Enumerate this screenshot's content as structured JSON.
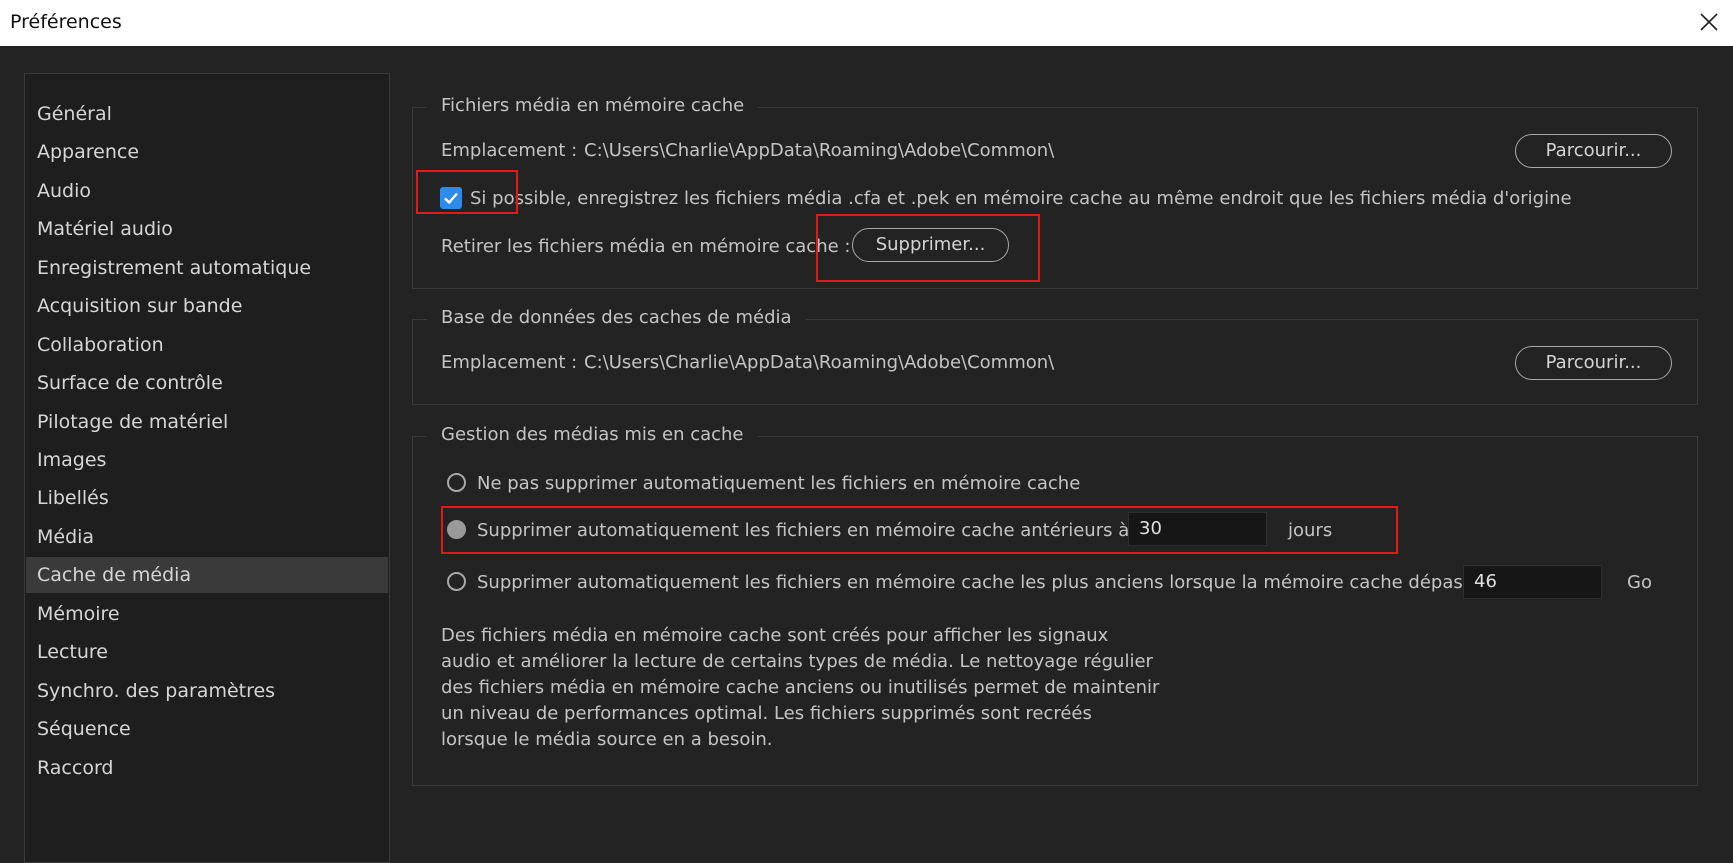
{
  "window": {
    "title": "Préférences"
  },
  "sidebar": {
    "items": [
      {
        "label": "Général"
      },
      {
        "label": "Apparence"
      },
      {
        "label": "Audio"
      },
      {
        "label": "Matériel audio"
      },
      {
        "label": "Enregistrement automatique"
      },
      {
        "label": "Acquisition sur bande"
      },
      {
        "label": "Collaboration"
      },
      {
        "label": "Surface de contrôle"
      },
      {
        "label": "Pilotage de matériel"
      },
      {
        "label": "Images"
      },
      {
        "label": "Libellés"
      },
      {
        "label": "Média"
      },
      {
        "label": "Cache de média",
        "selected": true
      },
      {
        "label": "Mémoire"
      },
      {
        "label": "Lecture"
      },
      {
        "label": "Synchro. des paramètres"
      },
      {
        "label": "Séquence"
      },
      {
        "label": "Raccord"
      }
    ]
  },
  "media_cache_files": {
    "title": "Fichiers média en mémoire cache",
    "location_label": "Emplacement :",
    "location_path": "C:\\Users\\Charlie\\AppData\\Roaming\\Adobe\\Common\\",
    "browse_label": "Parcourir...",
    "checkbox_label": "Si possible, enregistrez les fichiers média .cfa et .pek en mémoire cache au même endroit que les fichiers média d'origine",
    "checkbox_checked": true,
    "remove_label": "Retirer les fichiers média en mémoire cache :",
    "delete_button": "Supprimer..."
  },
  "media_cache_db": {
    "title": "Base de données des caches de média",
    "location_label": "Emplacement :",
    "location_path": "C:\\Users\\Charlie\\AppData\\Roaming\\Adobe\\Common\\",
    "browse_label": "Parcourir..."
  },
  "cache_management": {
    "title": "Gestion des médias mis en cache",
    "option1": "Ne pas supprimer automatiquement les fichiers en mémoire cache",
    "option2": "Supprimer automatiquement les fichiers en mémoire cache antérieurs à :",
    "option2_value": "30",
    "option2_unit": "jours",
    "option3": "Supprimer automatiquement les fichiers en mémoire cache les plus anciens lorsque la mémoire cache dépasse :",
    "option3_value": "46",
    "option3_unit": "Go",
    "selected_option": 2,
    "description": "Des fichiers média en mémoire cache sont créés pour afficher les signaux audio et améliorer la lecture de certains types de média. Le nettoyage régulier des fichiers média en mémoire cache anciens ou inutilisés permet de maintenir un niveau de performances optimal. Les fichiers supprimés sont recréés lorsque le média source en a besoin."
  },
  "colors": {
    "background": "#232323",
    "sidebar_bg": "#1e1e1e",
    "selected_item": "#3a3a3a",
    "checkbox": "#2d8ceb",
    "highlight": "#e0191b"
  }
}
